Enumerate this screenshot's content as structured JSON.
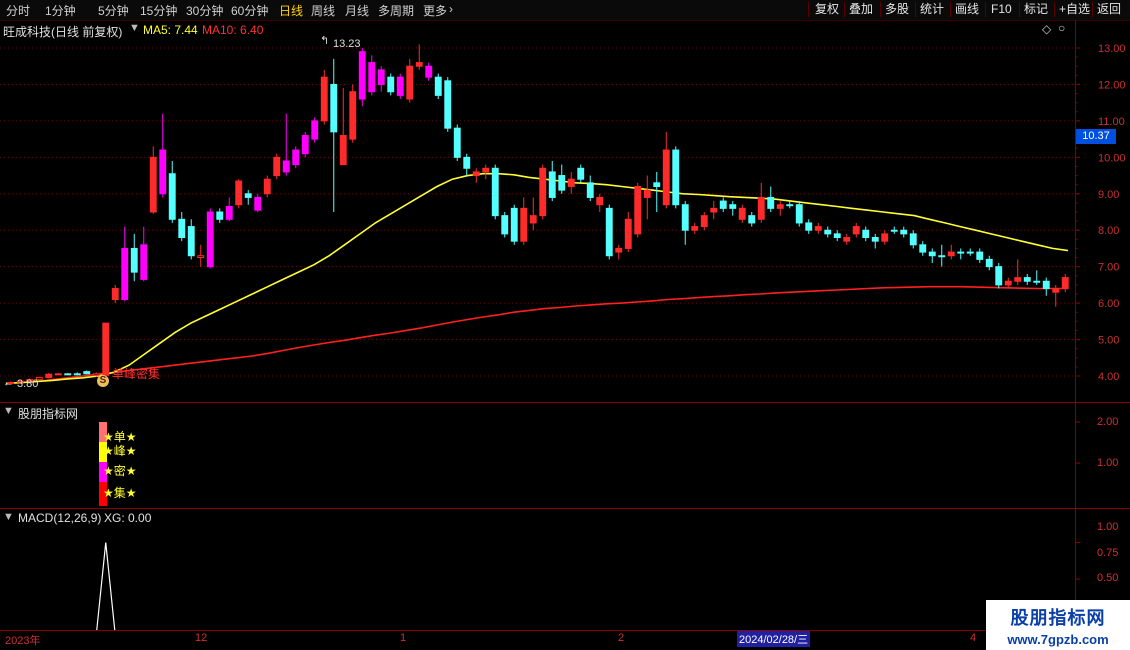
{
  "toolbar": {
    "timeframes": [
      "分时",
      "1分钟",
      "5分钟",
      "15分钟",
      "30分钟",
      "60分钟",
      "日线",
      "周线",
      "月线",
      "多周期",
      "更多"
    ],
    "active_timeframe": "日线",
    "right_buttons": [
      "复权",
      "叠加",
      "多股",
      "统计",
      "画线",
      "F10",
      "标记",
      "+自选",
      "返回"
    ]
  },
  "main_pane": {
    "stock_title": "旺成科技(日线 前复权)",
    "ma5_label": "MA5: 7.44",
    "ma10_label": "MA10: 6.40",
    "high_marker": "13.23",
    "low_marker": "3.80",
    "signal_text": "单峰密集",
    "signal_icon": "S",
    "current_price_tag": "10.37",
    "colors": {
      "ma5": "#ffff33",
      "ma10": "#ff2020",
      "up": "#ff2a2a",
      "down": "#54ffff",
      "magenta": "#ff00ff",
      "grid": "#6a0000"
    }
  },
  "indicator_pane": {
    "title": "股朋指标网",
    "labels": [
      "★单★",
      "★峰★",
      "★密★",
      "★集★"
    ],
    "y_ticks": [
      "2.00",
      "1.00"
    ]
  },
  "macd_pane": {
    "title": "MACD(12,26,9)",
    "xg_label": "XG: 0.00",
    "y_ticks": [
      "1.00",
      "0.75",
      "0.50"
    ]
  },
  "time_axis": {
    "labels": [
      "2023年",
      "12",
      "1",
      "2",
      "2024/02/28/三",
      "4"
    ]
  },
  "watermark": {
    "line1": "股朋指标网",
    "line2": "www.7gpzb.com"
  },
  "chart_data": {
    "type": "candlestick",
    "y_axis_ticks": [
      13.0,
      12.0,
      11.0,
      10.0,
      9.0,
      8.0,
      7.0,
      6.0,
      5.0,
      4.0
    ],
    "ylim": [
      3.5,
      13.5
    ],
    "candles": [
      {
        "o": 3.8,
        "c": 3.82,
        "h": 3.85,
        "l": 3.78,
        "k": "up"
      },
      {
        "o": 3.83,
        "c": 3.86,
        "h": 3.88,
        "l": 3.8,
        "k": "up"
      },
      {
        "o": 3.86,
        "c": 3.9,
        "h": 3.93,
        "l": 3.84,
        "k": "up"
      },
      {
        "o": 3.9,
        "c": 3.96,
        "h": 3.98,
        "l": 3.88,
        "k": "up"
      },
      {
        "o": 3.96,
        "c": 4.05,
        "h": 4.08,
        "l": 3.93,
        "k": "up"
      },
      {
        "o": 4.05,
        "c": 4.06,
        "h": 4.08,
        "l": 4.03,
        "k": "up"
      },
      {
        "o": 4.06,
        "c": 4.05,
        "h": 4.08,
        "l": 4.03,
        "k": "dn"
      },
      {
        "o": 4.06,
        "c": 4.06,
        "h": 4.1,
        "l": 4.02,
        "k": "dn"
      },
      {
        "o": 4.06,
        "c": 4.12,
        "h": 4.15,
        "l": 4.05,
        "k": "dn"
      },
      {
        "o": 4.02,
        "c": 4.06,
        "h": 4.1,
        "l": 3.98,
        "k": "up"
      },
      {
        "o": 4.02,
        "c": 5.45,
        "h": 5.45,
        "l": 4.0,
        "k": "up"
      },
      {
        "o": 6.1,
        "c": 6.4,
        "h": 6.5,
        "l": 6.0,
        "k": "up"
      },
      {
        "o": 6.1,
        "c": 7.5,
        "h": 8.1,
        "l": 6.05,
        "k": "mg"
      },
      {
        "o": 7.5,
        "c": 6.85,
        "h": 7.9,
        "l": 6.6,
        "k": "dn"
      },
      {
        "o": 6.65,
        "c": 7.6,
        "h": 8.1,
        "l": 6.6,
        "k": "mg"
      },
      {
        "o": 8.5,
        "c": 10.0,
        "h": 10.3,
        "l": 8.45,
        "k": "up"
      },
      {
        "o": 10.2,
        "c": 9.0,
        "h": 11.2,
        "l": 8.9,
        "k": "mg"
      },
      {
        "o": 9.55,
        "c": 8.3,
        "h": 9.9,
        "l": 8.2,
        "k": "dn"
      },
      {
        "o": 8.3,
        "c": 7.8,
        "h": 8.5,
        "l": 7.7,
        "k": "dn"
      },
      {
        "o": 8.1,
        "c": 7.3,
        "h": 8.3,
        "l": 7.2,
        "k": "dn"
      },
      {
        "o": 7.3,
        "c": 7.25,
        "h": 7.6,
        "l": 7.0,
        "k": "up"
      },
      {
        "o": 7.0,
        "c": 8.5,
        "h": 8.6,
        "l": 6.95,
        "k": "mg"
      },
      {
        "o": 8.5,
        "c": 8.3,
        "h": 8.6,
        "l": 8.2,
        "k": "dn"
      },
      {
        "o": 8.3,
        "c": 8.65,
        "h": 8.9,
        "l": 8.25,
        "k": "mg"
      },
      {
        "o": 8.7,
        "c": 9.35,
        "h": 9.4,
        "l": 8.6,
        "k": "up"
      },
      {
        "o": 9.0,
        "c": 8.9,
        "h": 9.1,
        "l": 8.7,
        "k": "dn"
      },
      {
        "o": 8.55,
        "c": 8.9,
        "h": 9.0,
        "l": 8.5,
        "k": "mg"
      },
      {
        "o": 9.0,
        "c": 9.4,
        "h": 9.5,
        "l": 8.9,
        "k": "up"
      },
      {
        "o": 9.5,
        "c": 10.0,
        "h": 10.1,
        "l": 9.4,
        "k": "up"
      },
      {
        "o": 9.9,
        "c": 9.6,
        "h": 11.2,
        "l": 9.5,
        "k": "mg"
      },
      {
        "o": 9.8,
        "c": 10.2,
        "h": 10.3,
        "l": 9.7,
        "k": "mg"
      },
      {
        "o": 10.1,
        "c": 10.6,
        "h": 10.7,
        "l": 10.0,
        "k": "mg"
      },
      {
        "o": 10.5,
        "c": 11.0,
        "h": 11.1,
        "l": 10.4,
        "k": "mg"
      },
      {
        "o": 11.0,
        "c": 12.2,
        "h": 12.4,
        "l": 10.9,
        "k": "up"
      },
      {
        "o": 12.0,
        "c": 10.7,
        "h": 12.7,
        "l": 8.5,
        "k": "dn"
      },
      {
        "o": 10.6,
        "c": 9.8,
        "h": 11.9,
        "l": 9.8,
        "k": "up"
      },
      {
        "o": 10.5,
        "c": 11.8,
        "h": 12.0,
        "l": 10.4,
        "k": "up"
      },
      {
        "o": 12.9,
        "c": 11.6,
        "h": 13.0,
        "l": 11.4,
        "k": "mg"
      },
      {
        "o": 11.8,
        "c": 12.6,
        "h": 12.8,
        "l": 11.7,
        "k": "mg"
      },
      {
        "o": 12.4,
        "c": 12.0,
        "h": 12.5,
        "l": 11.8,
        "k": "mg"
      },
      {
        "o": 12.2,
        "c": 11.8,
        "h": 12.3,
        "l": 11.7,
        "k": "dn"
      },
      {
        "o": 11.7,
        "c": 12.2,
        "h": 12.3,
        "l": 11.6,
        "k": "mg"
      },
      {
        "o": 11.6,
        "c": 12.5,
        "h": 12.7,
        "l": 11.5,
        "k": "up"
      },
      {
        "o": 12.5,
        "c": 12.6,
        "h": 13.1,
        "l": 12.4,
        "k": "up"
      },
      {
        "o": 12.5,
        "c": 12.2,
        "h": 12.6,
        "l": 12.1,
        "k": "mg"
      },
      {
        "o": 12.2,
        "c": 11.7,
        "h": 12.3,
        "l": 11.6,
        "k": "dn"
      },
      {
        "o": 12.1,
        "c": 10.8,
        "h": 12.2,
        "l": 10.7,
        "k": "dn"
      },
      {
        "o": 10.8,
        "c": 10.0,
        "h": 10.9,
        "l": 9.9,
        "k": "dn"
      },
      {
        "o": 10.0,
        "c": 9.7,
        "h": 10.1,
        "l": 9.5,
        "k": "dn"
      },
      {
        "o": 9.6,
        "c": 9.5,
        "h": 9.7,
        "l": 9.3,
        "k": "up"
      },
      {
        "o": 9.7,
        "c": 9.6,
        "h": 9.8,
        "l": 9.4,
        "k": "up"
      },
      {
        "o": 9.7,
        "c": 8.4,
        "h": 9.8,
        "l": 8.3,
        "k": "dn"
      },
      {
        "o": 8.4,
        "c": 7.9,
        "h": 8.5,
        "l": 7.8,
        "k": "dn"
      },
      {
        "o": 8.6,
        "c": 7.7,
        "h": 8.7,
        "l": 7.6,
        "k": "dn"
      },
      {
        "o": 7.7,
        "c": 8.6,
        "h": 8.9,
        "l": 7.6,
        "k": "up"
      },
      {
        "o": 8.4,
        "c": 8.2,
        "h": 8.9,
        "l": 8.0,
        "k": "up"
      },
      {
        "o": 8.4,
        "c": 9.7,
        "h": 9.8,
        "l": 8.3,
        "k": "up"
      },
      {
        "o": 9.6,
        "c": 8.9,
        "h": 9.9,
        "l": 8.8,
        "k": "dn"
      },
      {
        "o": 9.5,
        "c": 9.1,
        "h": 9.8,
        "l": 9.0,
        "k": "dn"
      },
      {
        "o": 9.2,
        "c": 9.4,
        "h": 9.6,
        "l": 9.0,
        "k": "up"
      },
      {
        "o": 9.4,
        "c": 9.7,
        "h": 9.8,
        "l": 9.3,
        "k": "dn"
      },
      {
        "o": 9.3,
        "c": 8.9,
        "h": 9.5,
        "l": 8.8,
        "k": "dn"
      },
      {
        "o": 8.9,
        "c": 8.7,
        "h": 9.0,
        "l": 8.5,
        "k": "up"
      },
      {
        "o": 8.6,
        "c": 7.3,
        "h": 8.7,
        "l": 7.2,
        "k": "dn"
      },
      {
        "o": 7.4,
        "c": 7.5,
        "h": 7.6,
        "l": 7.2,
        "k": "up"
      },
      {
        "o": 7.5,
        "c": 8.3,
        "h": 8.5,
        "l": 7.4,
        "k": "up"
      },
      {
        "o": 7.9,
        "c": 9.2,
        "h": 9.3,
        "l": 7.8,
        "k": "up"
      },
      {
        "o": 8.9,
        "c": 9.1,
        "h": 9.5,
        "l": 8.3,
        "k": "up"
      },
      {
        "o": 9.2,
        "c": 9.3,
        "h": 9.6,
        "l": 8.5,
        "k": "dn"
      },
      {
        "o": 8.7,
        "c": 10.2,
        "h": 10.7,
        "l": 8.6,
        "k": "up"
      },
      {
        "o": 10.2,
        "c": 8.7,
        "h": 10.3,
        "l": 8.6,
        "k": "dn"
      },
      {
        "o": 8.7,
        "c": 8.0,
        "h": 8.8,
        "l": 7.6,
        "k": "dn"
      },
      {
        "o": 8.0,
        "c": 8.1,
        "h": 8.2,
        "l": 7.9,
        "k": "up"
      },
      {
        "o": 8.1,
        "c": 8.4,
        "h": 8.5,
        "l": 8.0,
        "k": "up"
      },
      {
        "o": 8.5,
        "c": 8.6,
        "h": 8.8,
        "l": 8.3,
        "k": "up"
      },
      {
        "o": 8.6,
        "c": 8.8,
        "h": 8.9,
        "l": 8.5,
        "k": "dn"
      },
      {
        "o": 8.7,
        "c": 8.6,
        "h": 8.8,
        "l": 8.4,
        "k": "dn"
      },
      {
        "o": 8.6,
        "c": 8.3,
        "h": 8.7,
        "l": 8.2,
        "k": "up"
      },
      {
        "o": 8.4,
        "c": 8.2,
        "h": 8.5,
        "l": 8.1,
        "k": "dn"
      },
      {
        "o": 8.3,
        "c": 8.9,
        "h": 9.3,
        "l": 8.2,
        "k": "up"
      },
      {
        "o": 8.9,
        "c": 8.6,
        "h": 9.2,
        "l": 8.5,
        "k": "dn"
      },
      {
        "o": 8.6,
        "c": 8.7,
        "h": 8.8,
        "l": 8.4,
        "k": "up"
      },
      {
        "o": 8.7,
        "c": 8.7,
        "h": 8.8,
        "l": 8.6,
        "k": "dn"
      },
      {
        "o": 8.7,
        "c": 8.2,
        "h": 8.8,
        "l": 8.1,
        "k": "dn"
      },
      {
        "o": 8.2,
        "c": 8.0,
        "h": 8.3,
        "l": 7.9,
        "k": "dn"
      },
      {
        "o": 8.0,
        "c": 8.1,
        "h": 8.2,
        "l": 7.9,
        "k": "up"
      },
      {
        "o": 8.0,
        "c": 7.9,
        "h": 8.1,
        "l": 7.8,
        "k": "dn"
      },
      {
        "o": 7.9,
        "c": 7.8,
        "h": 8.0,
        "l": 7.7,
        "k": "dn"
      },
      {
        "o": 7.8,
        "c": 7.7,
        "h": 7.9,
        "l": 7.6,
        "k": "up"
      },
      {
        "o": 7.9,
        "c": 8.1,
        "h": 8.2,
        "l": 7.8,
        "k": "up"
      },
      {
        "o": 8.0,
        "c": 7.8,
        "h": 8.1,
        "l": 7.7,
        "k": "dn"
      },
      {
        "o": 7.8,
        "c": 7.7,
        "h": 7.9,
        "l": 7.5,
        "k": "dn"
      },
      {
        "o": 7.7,
        "c": 7.9,
        "h": 8.0,
        "l": 7.6,
        "k": "up"
      },
      {
        "o": 8.0,
        "c": 8.0,
        "h": 8.1,
        "l": 7.9,
        "k": "dn"
      },
      {
        "o": 8.0,
        "c": 7.9,
        "h": 8.1,
        "l": 7.8,
        "k": "dn"
      },
      {
        "o": 7.9,
        "c": 7.6,
        "h": 8.0,
        "l": 7.5,
        "k": "dn"
      },
      {
        "o": 7.6,
        "c": 7.4,
        "h": 7.7,
        "l": 7.3,
        "k": "dn"
      },
      {
        "o": 7.4,
        "c": 7.3,
        "h": 7.5,
        "l": 7.1,
        "k": "dn"
      },
      {
        "o": 7.3,
        "c": 7.3,
        "h": 7.6,
        "l": 7.0,
        "k": "dn"
      },
      {
        "o": 7.3,
        "c": 7.4,
        "h": 7.6,
        "l": 7.2,
        "k": "up"
      },
      {
        "o": 7.4,
        "c": 7.4,
        "h": 7.5,
        "l": 7.2,
        "k": "dn"
      },
      {
        "o": 7.4,
        "c": 7.4,
        "h": 7.5,
        "l": 7.3,
        "k": "dn"
      },
      {
        "o": 7.4,
        "c": 7.2,
        "h": 7.5,
        "l": 7.1,
        "k": "dn"
      },
      {
        "o": 7.2,
        "c": 7.0,
        "h": 7.3,
        "l": 6.9,
        "k": "dn"
      },
      {
        "o": 7.0,
        "c": 6.5,
        "h": 7.1,
        "l": 6.4,
        "k": "dn"
      },
      {
        "o": 6.5,
        "c": 6.6,
        "h": 6.7,
        "l": 6.4,
        "k": "up"
      },
      {
        "o": 6.6,
        "c": 6.7,
        "h": 7.2,
        "l": 6.5,
        "k": "up"
      },
      {
        "o": 6.7,
        "c": 6.6,
        "h": 6.8,
        "l": 6.5,
        "k": "dn"
      },
      {
        "o": 6.6,
        "c": 6.6,
        "h": 6.9,
        "l": 6.5,
        "k": "dn"
      },
      {
        "o": 6.6,
        "c": 6.4,
        "h": 6.7,
        "l": 6.2,
        "k": "dn"
      },
      {
        "o": 6.4,
        "c": 6.3,
        "h": 6.5,
        "l": 5.9,
        "k": "up"
      },
      {
        "o": 6.4,
        "c": 6.7,
        "h": 6.8,
        "l": 6.3,
        "k": "up"
      }
    ],
    "ma_yellow": [
      3.8,
      3.82,
      3.85,
      3.88,
      3.92,
      3.95,
      4.0,
      4.1,
      4.3,
      4.6,
      4.9,
      5.2,
      5.45,
      5.65,
      5.85,
      6.05,
      6.25,
      6.45,
      6.65,
      6.85,
      7.05,
      7.3,
      7.6,
      7.9,
      8.2,
      8.45,
      8.7,
      8.95,
      9.2,
      9.4,
      9.5,
      9.55,
      9.55,
      9.52,
      9.45,
      9.4,
      9.35,
      9.3,
      9.28,
      9.25,
      9.2,
      9.15,
      9.1,
      9.05,
      9.0,
      8.98,
      8.95,
      8.92,
      8.9,
      8.88,
      8.85,
      8.8,
      8.75,
      8.7,
      8.65,
      8.6,
      8.55,
      8.5,
      8.45,
      8.4,
      8.3,
      8.2,
      8.1,
      8.0,
      7.9,
      7.8,
      7.7,
      7.6,
      7.5,
      7.44
    ],
    "ma_red": [
      3.8,
      3.82,
      3.85,
      3.9,
      3.95,
      4.0,
      4.05,
      4.1,
      4.15,
      4.2,
      4.25,
      4.3,
      4.35,
      4.4,
      4.45,
      4.5,
      4.55,
      4.62,
      4.7,
      4.78,
      4.85,
      4.92,
      4.98,
      5.05,
      5.12,
      5.18,
      5.25,
      5.32,
      5.4,
      5.48,
      5.55,
      5.62,
      5.68,
      5.75,
      5.8,
      5.85,
      5.88,
      5.92,
      5.95,
      5.98,
      6.0,
      6.03,
      6.06,
      6.1,
      6.12,
      6.15,
      6.18,
      6.2,
      6.23,
      6.25,
      6.28,
      6.3,
      6.32,
      6.34,
      6.36,
      6.38,
      6.4,
      6.42,
      6.43,
      6.44,
      6.45,
      6.45,
      6.45,
      6.44,
      6.43,
      6.42,
      6.41,
      6.4,
      6.4,
      6.4
    ],
    "macd_xg": {
      "peak_value": 1.0,
      "ylim": [
        0.4,
        1.1
      ]
    }
  }
}
